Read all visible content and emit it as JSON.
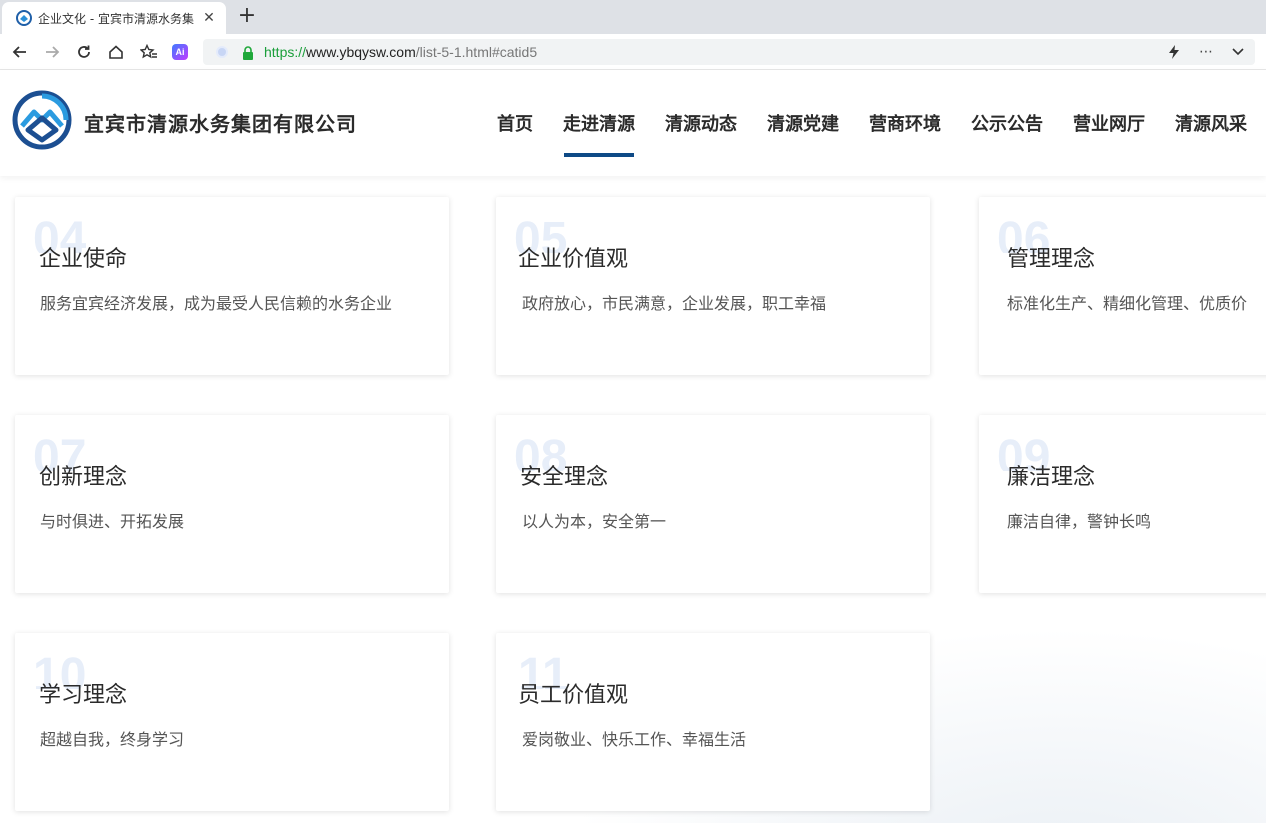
{
  "browser": {
    "tab_title": "企业文化 - 宜宾市清源水务集",
    "url_scheme": "https://",
    "url_host": "www.ybqysw.com",
    "url_path": "/list-5-1.html#catid5"
  },
  "site": {
    "company_name": "宜宾市清源水务集团有限公司",
    "brand_color": "#0e4a86",
    "nav": [
      {
        "label": "首页"
      },
      {
        "label": "走进清源",
        "active": true
      },
      {
        "label": "清源动态"
      },
      {
        "label": "清源党建"
      },
      {
        "label": "营商环境"
      },
      {
        "label": "公示公告"
      },
      {
        "label": "营业网厅"
      },
      {
        "label": "清源风采"
      }
    ]
  },
  "cards": [
    {
      "num": "04",
      "title": "企业使命",
      "desc": "服务宜宾经济发展，成为最受人民信赖的水务企业"
    },
    {
      "num": "05",
      "title": "企业价值观",
      "desc": "政府放心，市民满意，企业发展，职工幸福"
    },
    {
      "num": "06",
      "title": "管理理念",
      "desc": "标准化生产、精细化管理、优质价"
    },
    {
      "num": "07",
      "title": "创新理念",
      "desc": "与时俱进、开拓发展"
    },
    {
      "num": "08",
      "title": "安全理念",
      "desc": "以人为本，安全第一"
    },
    {
      "num": "09",
      "title": "廉洁理念",
      "desc": "廉洁自律，警钟长鸣"
    },
    {
      "num": "10",
      "title": "学习理念",
      "desc": "超越自我，终身学习"
    },
    {
      "num": "11",
      "title": "员工价值观",
      "desc": "爱岗敬业、快乐工作、幸福生活"
    }
  ]
}
